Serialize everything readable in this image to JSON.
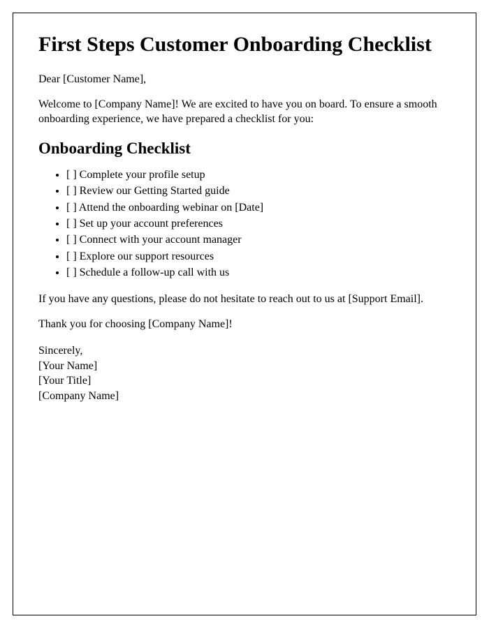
{
  "title": "First Steps Customer Onboarding Checklist",
  "greeting": "Dear [Customer Name],",
  "intro": "Welcome to [Company Name]! We are excited to have you on board. To ensure a smooth onboarding experience, we have prepared a checklist for you:",
  "checklist_heading": "Onboarding Checklist",
  "checklist_items": [
    "[ ] Complete your profile setup",
    "[ ] Review our Getting Started guide",
    "[ ] Attend the onboarding webinar on [Date]",
    "[ ] Set up your account preferences",
    "[ ] Connect with your account manager",
    "[ ] Explore our support resources",
    "[ ] Schedule a follow-up call with us"
  ],
  "footer_text": "If you have any questions, please do not hesitate to reach out to us at [Support Email].",
  "thank_you": "Thank you for choosing [Company Name]!",
  "signature": {
    "closing": "Sincerely,",
    "name": "[Your Name]",
    "title": "[Your Title]",
    "company": "[Company Name]"
  }
}
